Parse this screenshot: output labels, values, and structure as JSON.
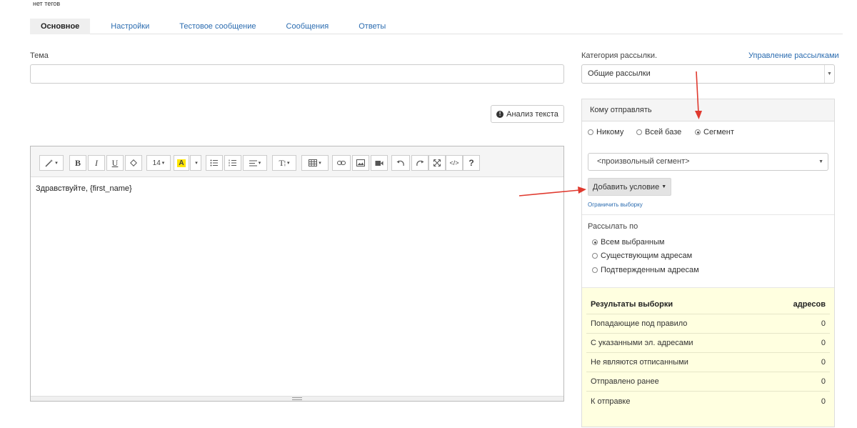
{
  "tags_text": "нет тегов",
  "tabs": [
    {
      "label": "Основное",
      "active": true
    },
    {
      "label": "Настройки",
      "active": false
    },
    {
      "label": "Тестовое сообщение",
      "active": false
    },
    {
      "label": "Сообщения",
      "active": false
    },
    {
      "label": "Ответы",
      "active": false
    }
  ],
  "subject": {
    "label": "Тема",
    "value": ""
  },
  "analyze_button": "Анализ текста",
  "editor": {
    "toolbar": [
      "magic-wand",
      "bold",
      "italic",
      "underline",
      "eraser",
      "font-size",
      "highlight",
      "unordered-list",
      "ordered-list",
      "align",
      "text-style",
      "table",
      "link",
      "image",
      "video",
      "undo",
      "redo",
      "fullscreen",
      "code-view",
      "help"
    ],
    "toolbar_labels": {
      "bold": "B",
      "italic": "I",
      "underline": "U",
      "font_size": "14",
      "highlight": "A",
      "text_style": "T",
      "help": "?",
      "code": "</>"
    },
    "content": "Здравствуйте, {first_name}"
  },
  "category": {
    "label": "Категория рассылки.",
    "manage_link": "Управление рассылками",
    "selected": "Общие рассылки"
  },
  "recipients": {
    "header": "Кому отправлять",
    "options": [
      {
        "label": "Никому",
        "checked": false
      },
      {
        "label": "Всей базе",
        "checked": false
      },
      {
        "label": "Сегмент",
        "checked": true
      }
    ],
    "segment_selected": "<произвольный сегмент>",
    "add_condition": "Добавить условие",
    "limit_link": "Ограничить выборку"
  },
  "send_by": {
    "label": "Рассылать по",
    "options": [
      {
        "label": "Всем выбранным",
        "checked": true
      },
      {
        "label": "Существующим адресам",
        "checked": false
      },
      {
        "label": "Подтвержденным адресам",
        "checked": false
      }
    ]
  },
  "results": {
    "title": "Результаты выборки",
    "unit": "адресов",
    "rows": [
      {
        "label": "Попадающие под правило",
        "value": "0"
      },
      {
        "label": "С указанными эл. адресами",
        "value": "0"
      },
      {
        "label": "Не являются отписанными",
        "value": "0"
      },
      {
        "label": "Отправлено ранее",
        "value": "0"
      },
      {
        "label": "К отправке",
        "value": "0"
      }
    ]
  },
  "colors": {
    "link": "#2b6cb0",
    "annotation_arrow": "#e03a2f",
    "results_bg": "#ffffe0"
  }
}
